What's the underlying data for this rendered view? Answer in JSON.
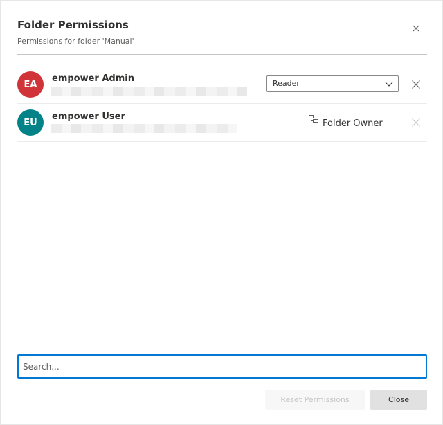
{
  "dialog": {
    "title": "Folder Permissions",
    "subtitle": "Permissions for folder 'Manual'"
  },
  "users": [
    {
      "initials": "EA",
      "name": "empower Admin",
      "avatar_color": "#d13438",
      "role": "Reader",
      "removable": true
    },
    {
      "initials": "EU",
      "name": "empower User",
      "avatar_color": "#038387",
      "role_label": "Folder Owner",
      "removable": false
    }
  ],
  "search": {
    "placeholder": "Search..."
  },
  "footer": {
    "reset_label": "Reset Permissions",
    "reset_disabled": true,
    "close_label": "Close"
  },
  "colors": {
    "accent": "#0078d4"
  }
}
